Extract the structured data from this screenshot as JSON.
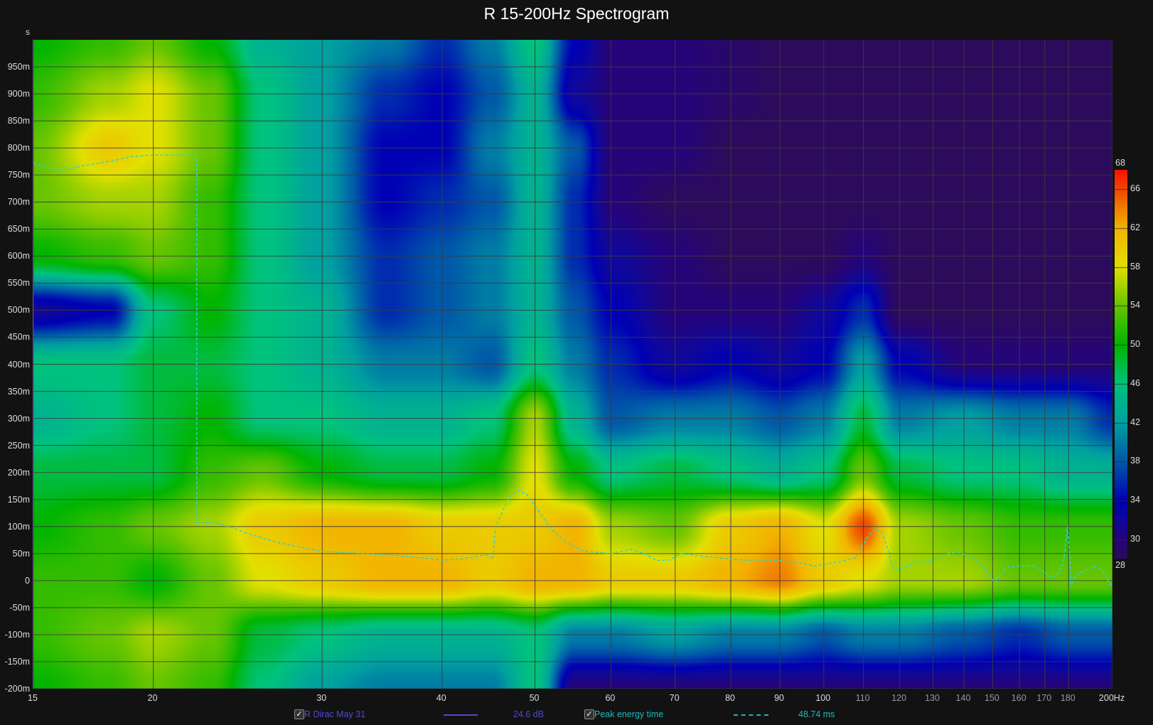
{
  "chart_data": {
    "type": "heatmap",
    "title": "R 15-200Hz Spectrogram",
    "ylabel": "s",
    "xunit": "Hz",
    "xscale": "log",
    "xlim": [
      15,
      200
    ],
    "ylim_ms": [
      -200,
      1000
    ],
    "x_ticks": [
      {
        "v": 15,
        "label": "15",
        "major": true
      },
      {
        "v": 20,
        "label": "20",
        "major": true
      },
      {
        "v": 30,
        "label": "30",
        "major": true
      },
      {
        "v": 40,
        "label": "40",
        "major": true
      },
      {
        "v": 50,
        "label": "50",
        "major": true
      },
      {
        "v": 60,
        "label": "60",
        "major": true
      },
      {
        "v": 70,
        "label": "70",
        "major": true
      },
      {
        "v": 80,
        "label": "80",
        "major": true
      },
      {
        "v": 90,
        "label": "90",
        "major": true
      },
      {
        "v": 100,
        "label": "100",
        "major": true
      },
      {
        "v": 110,
        "label": "110",
        "major": false
      },
      {
        "v": 120,
        "label": "120",
        "major": false
      },
      {
        "v": 130,
        "label": "130",
        "major": false
      },
      {
        "v": 140,
        "label": "140",
        "major": false
      },
      {
        "v": 150,
        "label": "150",
        "major": false
      },
      {
        "v": 160,
        "label": "160",
        "major": false
      },
      {
        "v": 170,
        "label": "170",
        "major": false
      },
      {
        "v": 180,
        "label": "180",
        "major": false
      },
      {
        "v": 200,
        "label": "200Hz",
        "major": true
      }
    ],
    "y_ticks": [
      {
        "v": 950,
        "label": "950m"
      },
      {
        "v": 900,
        "label": "900m"
      },
      {
        "v": 850,
        "label": "850m"
      },
      {
        "v": 800,
        "label": "800m"
      },
      {
        "v": 750,
        "label": "750m"
      },
      {
        "v": 700,
        "label": "700m"
      },
      {
        "v": 650,
        "label": "650m"
      },
      {
        "v": 600,
        "label": "600m"
      },
      {
        "v": 550,
        "label": "550m"
      },
      {
        "v": 500,
        "label": "500m"
      },
      {
        "v": 450,
        "label": "450m"
      },
      {
        "v": 400,
        "label": "400m"
      },
      {
        "v": 350,
        "label": "350m"
      },
      {
        "v": 300,
        "label": "300m"
      },
      {
        "v": 250,
        "label": "250m"
      },
      {
        "v": 200,
        "label": "200m"
      },
      {
        "v": 150,
        "label": "150m"
      },
      {
        "v": 100,
        "label": "100m"
      },
      {
        "v": 50,
        "label": "50m"
      },
      {
        "v": 0,
        "label": "0"
      },
      {
        "v": -50,
        "label": "-50m"
      },
      {
        "v": -100,
        "label": "-100m"
      },
      {
        "v": -150,
        "label": "-150m"
      },
      {
        "v": -200,
        "label": "-200m"
      }
    ],
    "colorbar": {
      "range": [
        28,
        68
      ],
      "ticks": [
        {
          "v": 68,
          "label": "68"
        },
        {
          "v": 66,
          "label": "66"
        },
        {
          "v": 62,
          "label": "62"
        },
        {
          "v": 58,
          "label": "58"
        },
        {
          "v": 54,
          "label": "54"
        },
        {
          "v": 50,
          "label": "50"
        },
        {
          "v": 46,
          "label": "46"
        },
        {
          "v": 42,
          "label": "42"
        },
        {
          "v": 38,
          "label": "38"
        },
        {
          "v": 34,
          "label": "34"
        },
        {
          "v": 30,
          "label": "30"
        },
        {
          "v": 28,
          "label": "28"
        }
      ],
      "stops": [
        [
          28,
          "#2c0b5c"
        ],
        [
          30,
          "#25047a"
        ],
        [
          32,
          "#10089a"
        ],
        [
          34,
          "#0000b4"
        ],
        [
          38,
          "#0058a8"
        ],
        [
          42,
          "#00a0a0"
        ],
        [
          46,
          "#00c27e"
        ],
        [
          50,
          "#00b400"
        ],
        [
          54,
          "#66c400"
        ],
        [
          58,
          "#e2e000"
        ],
        [
          62,
          "#f2b400"
        ],
        [
          64,
          "#f08000"
        ],
        [
          66,
          "#f04800"
        ],
        [
          68,
          "#ff1000"
        ]
      ]
    },
    "grid_freqs": [
      15,
      18,
      20,
      23,
      26,
      30,
      35,
      40,
      45,
      50,
      55,
      60,
      70,
      80,
      90,
      100,
      110,
      120,
      140,
      160,
      180,
      200
    ],
    "grid_times_ms": [
      1000,
      900,
      800,
      700,
      600,
      500,
      400,
      300,
      200,
      100,
      0,
      -100,
      -200
    ],
    "levels_db": [
      [
        50,
        52,
        54,
        50,
        44,
        42,
        40,
        36,
        40,
        46,
        34,
        30,
        30,
        29,
        28,
        28,
        28,
        28,
        28,
        28,
        28,
        28
      ],
      [
        52,
        56,
        58,
        54,
        46,
        42,
        36,
        34,
        38,
        44,
        32,
        30,
        30,
        29,
        28,
        28,
        28,
        28,
        28,
        28,
        28,
        28
      ],
      [
        54,
        60,
        58,
        54,
        46,
        42,
        34,
        34,
        40,
        44,
        38,
        30,
        30,
        28,
        28,
        28,
        28,
        28,
        28,
        28,
        28,
        28
      ],
      [
        54,
        56,
        56,
        52,
        46,
        42,
        34,
        36,
        38,
        44,
        36,
        30,
        28,
        28,
        28,
        28,
        28,
        28,
        28,
        28,
        28,
        28
      ],
      [
        50,
        52,
        54,
        52,
        46,
        42,
        36,
        38,
        40,
        44,
        36,
        32,
        30,
        28,
        28,
        28,
        30,
        28,
        28,
        28,
        28,
        28
      ],
      [
        32,
        34,
        46,
        50,
        46,
        44,
        36,
        38,
        40,
        44,
        38,
        34,
        30,
        30,
        30,
        32,
        36,
        28,
        28,
        28,
        28,
        28
      ],
      [
        46,
        46,
        48,
        48,
        46,
        44,
        40,
        40,
        38,
        46,
        40,
        36,
        32,
        34,
        32,
        34,
        42,
        34,
        30,
        30,
        30,
        30
      ],
      [
        44,
        46,
        48,
        50,
        46,
        46,
        44,
        44,
        46,
        56,
        44,
        38,
        40,
        40,
        38,
        40,
        48,
        40,
        42,
        40,
        40,
        36
      ],
      [
        48,
        48,
        48,
        52,
        54,
        50,
        48,
        48,
        50,
        58,
        50,
        46,
        48,
        46,
        44,
        46,
        54,
        48,
        46,
        46,
        44,
        44
      ],
      [
        50,
        52,
        54,
        56,
        60,
        62,
        62,
        60,
        60,
        60,
        62,
        56,
        54,
        60,
        62,
        58,
        66,
        56,
        54,
        52,
        52,
        52
      ],
      [
        52,
        52,
        50,
        54,
        58,
        60,
        62,
        62,
        60,
        62,
        62,
        60,
        60,
        62,
        64,
        60,
        58,
        56,
        56,
        54,
        54,
        54
      ],
      [
        52,
        54,
        56,
        54,
        48,
        46,
        44,
        44,
        44,
        46,
        40,
        40,
        42,
        40,
        40,
        38,
        40,
        40,
        38,
        36,
        38,
        38
      ],
      [
        50,
        52,
        54,
        52,
        46,
        42,
        40,
        40,
        40,
        46,
        30,
        30,
        30,
        30,
        30,
        30,
        30,
        30,
        30,
        30,
        30,
        30
      ]
    ],
    "series": [
      {
        "name": "Peak energy time",
        "color": "#2ad4d4",
        "style": "dashed",
        "points": [
          [
            15,
            772
          ],
          [
            16,
            758
          ],
          [
            17,
            768
          ],
          [
            18,
            775
          ],
          [
            19,
            784
          ],
          [
            20,
            787
          ],
          [
            22.2,
            787
          ],
          [
            22.2,
            108
          ],
          [
            23,
            108
          ],
          [
            24,
            100
          ],
          [
            25,
            88
          ],
          [
            27,
            70
          ],
          [
            30,
            54
          ],
          [
            35,
            48
          ],
          [
            38,
            42
          ],
          [
            40,
            38
          ],
          [
            42,
            40
          ],
          [
            44.5,
            48
          ],
          [
            45.2,
            40
          ],
          [
            45.5,
            100
          ],
          [
            47,
            155
          ],
          [
            48,
            167
          ],
          [
            49,
            160
          ],
          [
            50,
            138
          ],
          [
            52,
            95
          ],
          [
            54,
            70
          ],
          [
            56,
            55
          ],
          [
            60,
            50
          ],
          [
            63,
            58
          ],
          [
            65,
            50
          ],
          [
            67,
            37
          ],
          [
            69,
            38
          ],
          [
            71,
            50
          ],
          [
            75,
            45
          ],
          [
            80,
            40
          ],
          [
            85,
            36
          ],
          [
            90,
            37
          ],
          [
            95,
            32
          ],
          [
            98,
            27
          ],
          [
            100,
            30
          ],
          [
            104,
            35
          ],
          [
            108,
            42
          ],
          [
            111,
            80
          ],
          [
            113,
            95
          ],
          [
            115,
            90
          ],
          [
            117,
            50
          ],
          [
            118,
            25
          ],
          [
            120,
            22
          ],
          [
            124,
            32
          ],
          [
            130,
            38
          ],
          [
            135,
            50
          ],
          [
            138,
            52
          ],
          [
            142,
            45
          ],
          [
            147,
            25
          ],
          [
            149,
            5
          ],
          [
            151,
            -3
          ],
          [
            153,
            10
          ],
          [
            155,
            25
          ],
          [
            160,
            27
          ],
          [
            165,
            28
          ],
          [
            170,
            15
          ],
          [
            173,
            5
          ],
          [
            176,
            15
          ],
          [
            178,
            40
          ],
          [
            179.5,
            100
          ],
          [
            180.5,
            50
          ],
          [
            181,
            -12
          ],
          [
            183,
            10
          ],
          [
            188,
            20
          ],
          [
            192,
            27
          ],
          [
            196,
            15
          ],
          [
            199,
            -8
          ],
          [
            200,
            -5
          ]
        ]
      }
    ]
  },
  "legend": {
    "item1": {
      "label": "R Dirac May 31",
      "value": "24.6 dB",
      "color": "#5048d0",
      "checked": true
    },
    "item2": {
      "label": "Peak energy time",
      "value": "48.74 ms",
      "color": "#20b8b8",
      "checked": true
    }
  }
}
